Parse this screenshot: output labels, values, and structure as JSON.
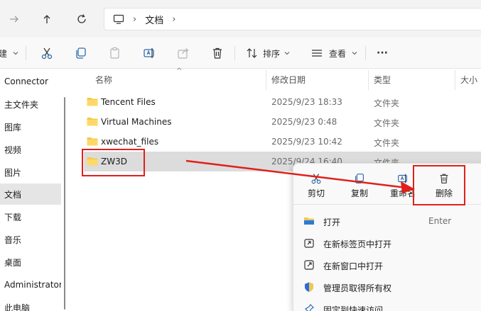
{
  "address": {
    "breadcrumb": [
      "文档"
    ]
  },
  "toolbar": {
    "new_label": "建",
    "sort_label": "排序",
    "view_label": "查看",
    "more_label": "···"
  },
  "sidebar": {
    "items": [
      {
        "label": "Connector"
      },
      {
        "label": "主文件夹"
      },
      {
        "label": "图库"
      },
      {
        "label": "视频"
      },
      {
        "label": "图片"
      },
      {
        "label": "文档"
      },
      {
        "label": "下载"
      },
      {
        "label": "音乐"
      },
      {
        "label": "桌面"
      },
      {
        "label": "Administrator"
      },
      {
        "label": "此电脑"
      }
    ],
    "selected_index": 5
  },
  "filelist": {
    "columns": {
      "name": "名称",
      "date": "修改日期",
      "type": "类型",
      "size": "大小"
    },
    "rows": [
      {
        "name": "Tencent Files",
        "date": "2025/9/23 18:33",
        "type": "文件夹"
      },
      {
        "name": "Virtual Machines",
        "date": "2025/9/23 0:48",
        "type": "文件夹"
      },
      {
        "name": "xwechat_files",
        "date": "2025/9/23 10:42",
        "type": "文件夹"
      },
      {
        "name": "ZW3D",
        "date": "2025/9/24 16:40",
        "type": "文件夹"
      }
    ],
    "selected_index": 3
  },
  "context_menu": {
    "quick": [
      {
        "label": "剪切",
        "icon": "cut-icon"
      },
      {
        "label": "复制",
        "icon": "copy-icon"
      },
      {
        "label": "重命名",
        "icon": "rename-icon"
      },
      {
        "label": "删除",
        "icon": "delete-icon"
      }
    ],
    "items": [
      {
        "label": "打开",
        "shortcut": "Enter",
        "icon": "folder-open-icon"
      },
      {
        "label": "在新标签页中打开",
        "icon": "new-tab-icon"
      },
      {
        "label": "在新窗口中打开",
        "icon": "new-window-icon"
      },
      {
        "label": "管理员取得所有权",
        "icon": "shield-icon"
      },
      {
        "label": "固定到快速访问",
        "icon": "pin-icon"
      }
    ]
  },
  "colors": {
    "annotation": "#e0201a",
    "folder": "#f2c94c",
    "selection": "#dcdcdc"
  }
}
